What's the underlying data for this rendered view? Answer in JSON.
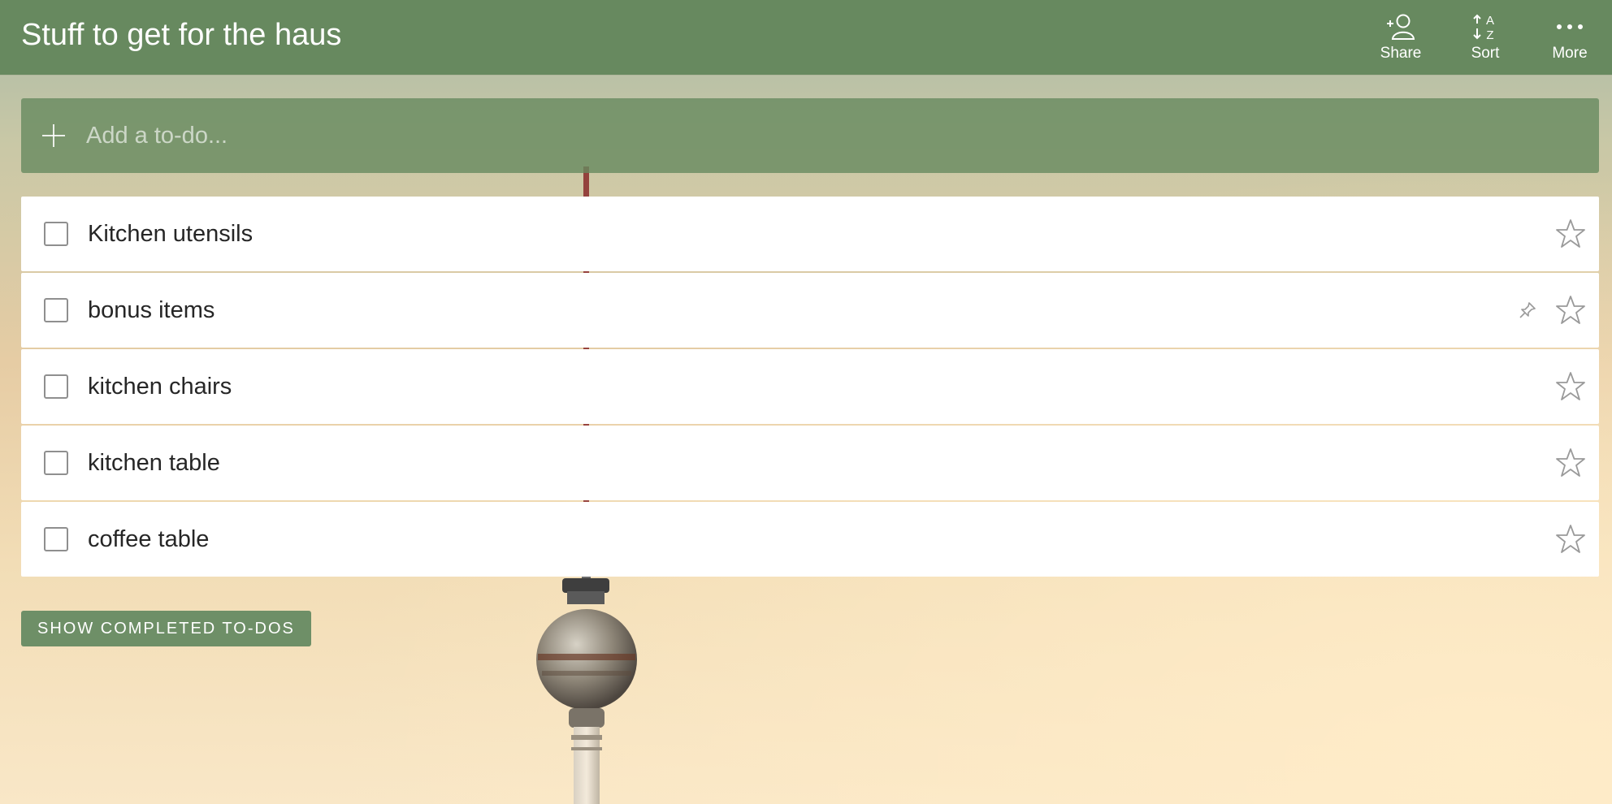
{
  "header": {
    "list_title": "Stuff to get for the haus",
    "actions": [
      {
        "label": "Share",
        "icon": "share-person-icon"
      },
      {
        "label": "Sort",
        "icon": "sort-az-icon"
      },
      {
        "label": "More",
        "icon": "more-dots-icon"
      }
    ],
    "background_color": "#67895f"
  },
  "add_todo": {
    "placeholder": "Add a to-do...",
    "value": "",
    "icon": "plus-icon"
  },
  "tasks": [
    {
      "title": "Kitchen utensils",
      "completed": false,
      "starred": false,
      "has_pin": false
    },
    {
      "title": "bonus items",
      "completed": false,
      "starred": false,
      "has_pin": true
    },
    {
      "title": "kitchen chairs",
      "completed": false,
      "starred": false,
      "has_pin": false
    },
    {
      "title": "kitchen table",
      "completed": false,
      "starred": false,
      "has_pin": false
    },
    {
      "title": "coffee table",
      "completed": false,
      "starred": false,
      "has_pin": false
    }
  ],
  "show_completed_label": "SHOW COMPLETED TO-DOS",
  "colors": {
    "accent": "#67895f",
    "task_background": "#ffffff",
    "task_text": "#262626"
  }
}
